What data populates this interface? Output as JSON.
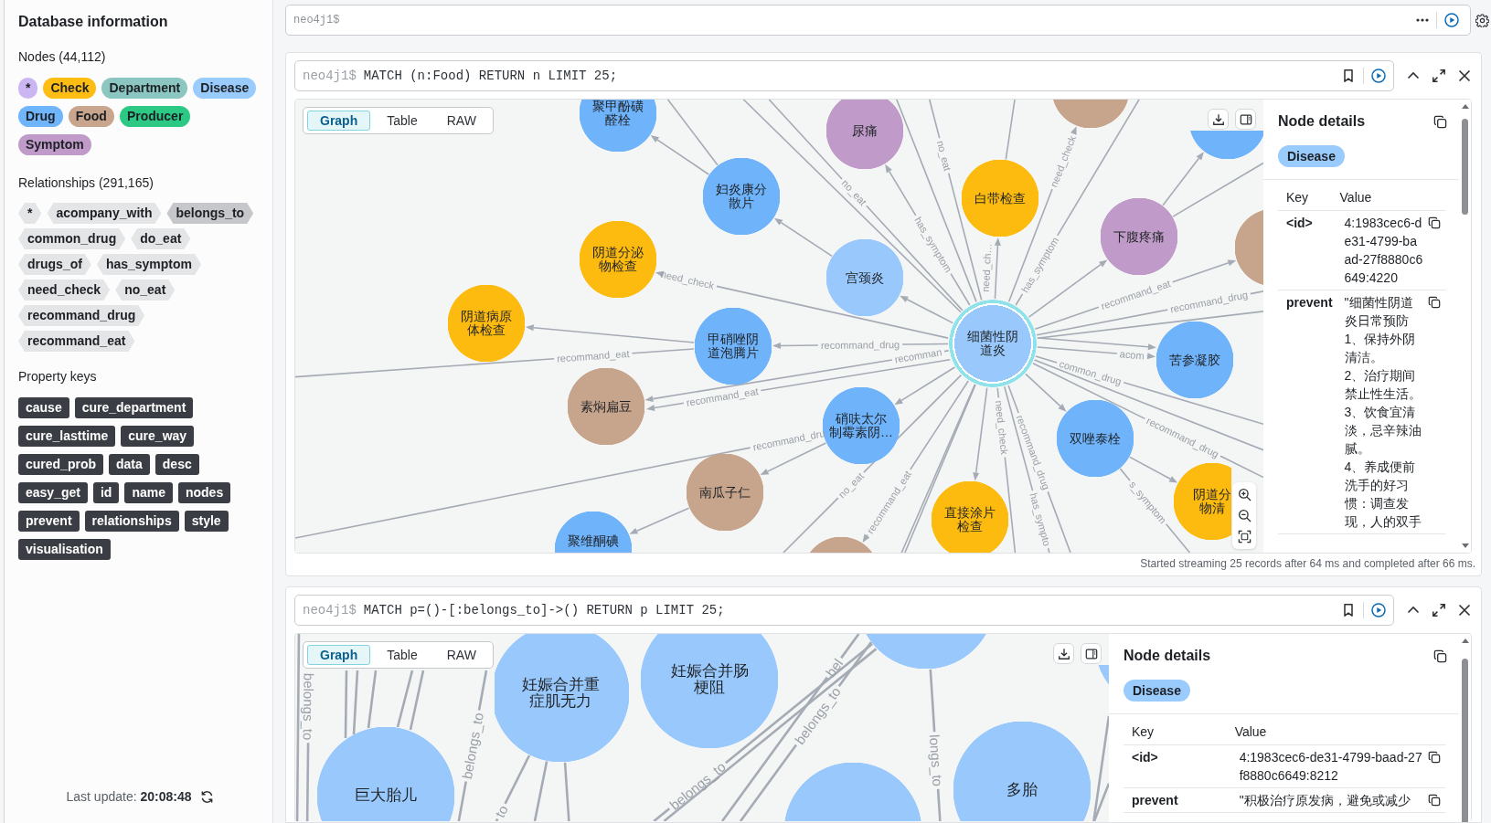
{
  "sidebar": {
    "title": "Database information",
    "nodes_heading": "Nodes (44,112)",
    "node_labels": [
      {
        "text": "*",
        "color": "#c9b6f2"
      },
      {
        "text": "Check",
        "color": "#fdbd12"
      },
      {
        "text": "Department",
        "color": "#8cc6c0"
      },
      {
        "text": "Disease",
        "color": "#9acbfd"
      },
      {
        "text": "Drug",
        "color": "#6fb5fb"
      },
      {
        "text": "Food",
        "color": "#c8a58c"
      },
      {
        "text": "Producer",
        "color": "#2cc985"
      },
      {
        "text": "Symptom",
        "color": "#c09bc9"
      }
    ],
    "relationships_heading": "Relationships (291,165)",
    "relationship_types": [
      {
        "text": "*",
        "color": "#e4e5e7"
      },
      {
        "text": "acompany_with",
        "color": "#e4e5e7"
      },
      {
        "text": "belongs_to",
        "color": "#c6c7ca"
      },
      {
        "text": "common_drug",
        "color": "#e4e5e7"
      },
      {
        "text": "do_eat",
        "color": "#e4e5e7"
      },
      {
        "text": "drugs_of",
        "color": "#e4e5e7"
      },
      {
        "text": "has_symptom",
        "color": "#e4e5e7"
      },
      {
        "text": "need_check",
        "color": "#e4e5e7"
      },
      {
        "text": "no_eat",
        "color": "#e4e5e7"
      },
      {
        "text": "recommand_drug",
        "color": "#e4e5e7"
      },
      {
        "text": "recommand_eat",
        "color": "#e4e5e7"
      }
    ],
    "property_keys_heading": "Property keys",
    "property_keys": [
      "cause",
      "cure_department",
      "cure_lasttime",
      "cure_way",
      "cured_prob",
      "data",
      "desc",
      "easy_get",
      "id",
      "name",
      "nodes",
      "prevent",
      "relationships",
      "style",
      "visualisation"
    ],
    "last_update": "Last update: **20:08:48**"
  },
  "editor": {
    "prompt": "neo4j1$"
  },
  "frames": [
    {
      "prompt": "neo4j1$",
      "query": "MATCH (n:Food) RETURN n LIMIT 25;",
      "view_tabs": [
        {
          "text": "Graph",
          "selected": true
        },
        {
          "text": "Table",
          "selected": false
        },
        {
          "text": "RAW",
          "selected": false
        }
      ],
      "graph": {
        "nodes": [
          {
            "label": "细菌性阴道炎",
            "color": "#99c9fc",
            "selected": true
          },
          {
            "label": "聚甲酚磺醛栓",
            "color": "#6fb3fb",
            "selected": false
          },
          {
            "label": "妇炎康分散片",
            "color": "#6fb3fb",
            "selected": false
          },
          {
            "label": "尿痛",
            "color": "#c09bc9",
            "selected": false
          },
          {
            "label": "阴道分泌物检查",
            "color": "#fdbb10",
            "selected": false
          },
          {
            "label": "宫颈炎",
            "color": "#99c9fc",
            "selected": false
          },
          {
            "label": "阴道病原体检查",
            "color": "#fdbb10",
            "selected": false
          },
          {
            "label": "甲硝唑阴道泡腾片",
            "color": "#6fb3fb",
            "selected": false
          },
          {
            "label": "素焖扁豆",
            "color": "#c7a48c",
            "selected": false
          },
          {
            "label": "硝呋太尔制霉素阴…",
            "color": "#6fb3fb",
            "selected": false
          },
          {
            "label": "南瓜子仁",
            "color": "#c7a48c",
            "selected": false
          },
          {
            "label": "聚维酮碘",
            "color": "#6fb3fb",
            "selected": false
          },
          {
            "color": "#c7a48c",
            "selected": false
          },
          {
            "label": "白带检查",
            "color": "#fdbb10",
            "selected": false
          },
          {
            "color": "#6fb3fb",
            "selected": false
          },
          {
            "label": "下腹疼痛",
            "color": "#c09bc9",
            "selected": false
          },
          {
            "color": "#c7a48c",
            "selected": false
          },
          {
            "label": "苦参凝胶",
            "color": "#6fb3fb",
            "selected": false
          },
          {
            "label": "双唑泰栓",
            "color": "#6fb3fb",
            "selected": false
          },
          {
            "label": "阴道分物清",
            "color": "#fdbb10",
            "selected": false
          },
          {
            "label": "直接涂片检查",
            "color": "#fdbb10",
            "selected": false
          },
          {
            "color": "#c7a48c",
            "selected": false
          }
        ],
        "edges": [
          {
            "kind": "arrow"
          },
          {
            "kind": "arrow",
            "label": "recommand_drug"
          },
          {
            "kind": "arrow",
            "label": "recommand_eat"
          },
          {
            "kind": "line",
            "label": "recommand_eat"
          },
          {
            "kind": "arrow"
          },
          {
            "kind": "arrow",
            "label": "need_check"
          },
          {
            "kind": "arrow"
          },
          {
            "kind": "arrow"
          },
          {
            "kind": "arrow"
          },
          {
            "kind": "arrow"
          },
          {
            "kind": "line",
            "label": "no_eat"
          },
          {
            "kind": "arrow",
            "label": "recommand_eat"
          },
          {
            "kind": "line"
          },
          {
            "kind": "arrow"
          },
          {
            "kind": "arrow"
          },
          {
            "kind": "line",
            "label": "recommand_drug"
          },
          {
            "kind": "arrow"
          },
          {
            "kind": "arrow",
            "label": "acom"
          },
          {
            "kind": "line",
            "label": "common_drug"
          },
          {
            "kind": "arrow"
          },
          {
            "kind": "arrow",
            "label": "recommand_eat"
          },
          {
            "kind": "line",
            "label": "recommand_drug"
          },
          {
            "kind": "line"
          },
          {
            "kind": "arrow"
          },
          {
            "kind": "arrow"
          },
          {
            "kind": "arrow",
            "label": "need_ch…"
          },
          {
            "kind": "arrow",
            "label": "need_check"
          },
          {
            "kind": "line",
            "label": "no_eat"
          },
          {
            "kind": "arrow",
            "label": "has_symptom"
          },
          {
            "kind": "line"
          },
          {
            "kind": "line",
            "label": "no_eat"
          },
          {
            "kind": "line"
          },
          {
            "kind": "line"
          },
          {
            "kind": "arrow"
          },
          {
            "kind": "line",
            "label": "s_symptom"
          },
          {
            "kind": "line",
            "label": "recommand_drug"
          },
          {
            "kind": "line",
            "label": "has_sympto"
          },
          {
            "kind": "line"
          },
          {
            "kind": "line"
          },
          {
            "kind": "line",
            "label": "has_symptom"
          },
          {
            "kind": "line"
          },
          {
            "kind": "line"
          },
          {
            "kind": "line",
            "label": "need_check"
          },
          {
            "kind": "arrow",
            "label": "recomman"
          },
          {
            "kind": "line",
            "label": "recommand_dru"
          }
        ]
      },
      "details": {
        "title": "Node details",
        "labels": [
          {
            "text": "Disease",
            "color": "#9acbfd"
          }
        ],
        "columns": [
          "Key",
          "Value"
        ],
        "properties": [
          {
            "key": "<id>",
            "value": "4:1983cec6-de31-4799-baad-27f8880c6649:4220"
          },
          {
            "key": "prevent",
            "value": "\"细菌性阴道炎日常预防\n1、保持外阴清洁。\n2、治疗期间禁止性生活。\n3、饮食宜清淡，忌辛辣油腻。\n4、养成便前洗手的好习惯：调查发现，人的双手"
          }
        ]
      },
      "status": "Started streaming 25 records after 64 ms and completed after 66 ms."
    },
    {
      "prompt": "neo4j1$",
      "query": "MATCH p=()-[:belongs_to]->() RETURN p LIMIT 25;",
      "view_tabs": [
        {
          "text": "Graph",
          "selected": true
        },
        {
          "text": "Table",
          "selected": false
        },
        {
          "text": "RAW",
          "selected": false
        }
      ],
      "graph": {
        "nodes": [
          {
            "label": "巨大胎儿",
            "color": "#99c9fc",
            "selected": false
          },
          {
            "label": "妊娠合并重症肌无力",
            "color": "#99c9fc",
            "selected": false
          },
          {
            "label": "妊娠合并肠梗阻",
            "color": "#99c9fc",
            "selected": false
          },
          {
            "color": "#99c9fc",
            "selected": false
          },
          {
            "color": "#99c9fc",
            "selected": false
          },
          {
            "label": "多胎",
            "color": "#99c9fc",
            "selected": false
          },
          {
            "color": "#99c9fc",
            "selected": false
          }
        ],
        "edges": [
          {
            "kind": "line"
          },
          {
            "kind": "line",
            "label": "belongs_to"
          },
          {
            "kind": "line"
          },
          {
            "kind": "line"
          },
          {
            "kind": "line"
          },
          {
            "kind": "line"
          },
          {
            "kind": "line"
          },
          {
            "kind": "line",
            "label": "belongs_to"
          },
          {
            "kind": "line",
            "label": "to"
          },
          {
            "kind": "line"
          },
          {
            "kind": "line"
          },
          {
            "kind": "line",
            "label": "belongs_to"
          },
          {
            "kind": "line"
          },
          {
            "kind": "line",
            "label": "belongs_to"
          },
          {
            "kind": "line",
            "label": "bel"
          },
          {
            "kind": "line",
            "label": "longs_to"
          },
          {
            "kind": "line"
          },
          {
            "kind": "line"
          }
        ]
      },
      "details": {
        "title": "Node details",
        "labels": [
          {
            "text": "Disease",
            "color": "#9acbfd"
          }
        ],
        "columns": [
          "Key",
          "Value"
        ],
        "properties": [
          {
            "key": "<id>",
            "value": "4:1983cec6-de31-4799-baad-27f8880c6649:8212"
          },
          {
            "key": "prevent",
            "value": "\"积极治疗原发病，避免或减少"
          }
        ]
      }
    }
  ]
}
